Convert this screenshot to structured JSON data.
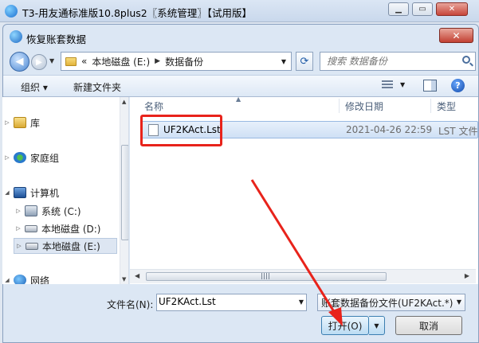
{
  "app": {
    "title": "T3-用友通标准版10.8plus2〖系统管理〗【试用版】"
  },
  "dialog": {
    "title": "恢复账套数据",
    "address": {
      "overflow": "«",
      "crumbs": [
        "本地磁盘 (E:)",
        "数据备份"
      ]
    },
    "search": {
      "placeholder": "搜索 数据备份"
    },
    "toolbar": {
      "organize": "组织 ▾",
      "new_folder": "新建文件夹",
      "help": "?"
    },
    "nav": {
      "items": [
        {
          "label": "库",
          "icon": "library-icon"
        },
        {
          "label": "家庭组",
          "icon": "homegroup-icon"
        },
        {
          "label": "计算机",
          "icon": "computer-icon"
        },
        {
          "label": "系统 (C:)",
          "icon": "system-drive-icon"
        },
        {
          "label": "本地磁盘 (D:)",
          "icon": "drive-icon"
        },
        {
          "label": "本地磁盘 (E:)",
          "icon": "drive-icon"
        },
        {
          "label": "网络",
          "icon": "network-icon"
        }
      ]
    },
    "columns": {
      "name": "名称",
      "date": "修改日期",
      "type": "类型"
    },
    "files": [
      {
        "name": "UF2KAct.Lst",
        "date": "2021-04-26 22:59",
        "type": "LST 文件"
      }
    ],
    "filename_label": "文件名(N):",
    "filename_value": "UF2KAct.Lst",
    "filetype_value": "账套数据备份文件(UF2KAct.*)",
    "open_label": "打开(O)",
    "cancel_label": "取消"
  },
  "colors": {
    "highlight": "#e8231b",
    "selection": "#cfe0f5"
  }
}
